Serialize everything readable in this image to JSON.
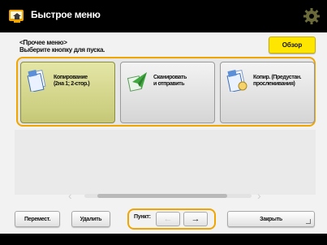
{
  "titlebar": {
    "title": "Быстрое меню",
    "home_icon": "home-icon",
    "settings_icon": "gear-icon"
  },
  "header": {
    "line1": "<Прочее меню>",
    "line2": "Выберите кнопку для пуска.",
    "overview_label": "Обзор"
  },
  "cards": [
    {
      "label_line1": "Копирование",
      "label_line2": "(2на 1; 2-стор.)",
      "icon": "copy-document-icon",
      "selected": true
    },
    {
      "label_line1": "Сканировать",
      "label_line2": "и отправить",
      "icon": "scan-send-icon",
      "selected": false
    },
    {
      "label_line1": "Копир. (Предустан.",
      "label_line2": "прослеживания)",
      "icon": "copy-preset-icon",
      "selected": false
    }
  ],
  "bottom": {
    "move_label": "Перемест.",
    "delete_label": "Удалить",
    "order_label": "Пункт:",
    "close_label": "Закрыть"
  },
  "colors": {
    "accent_frame": "#f0a500",
    "overview_button": "#ffe600",
    "selected_card": "#d7d98f"
  }
}
